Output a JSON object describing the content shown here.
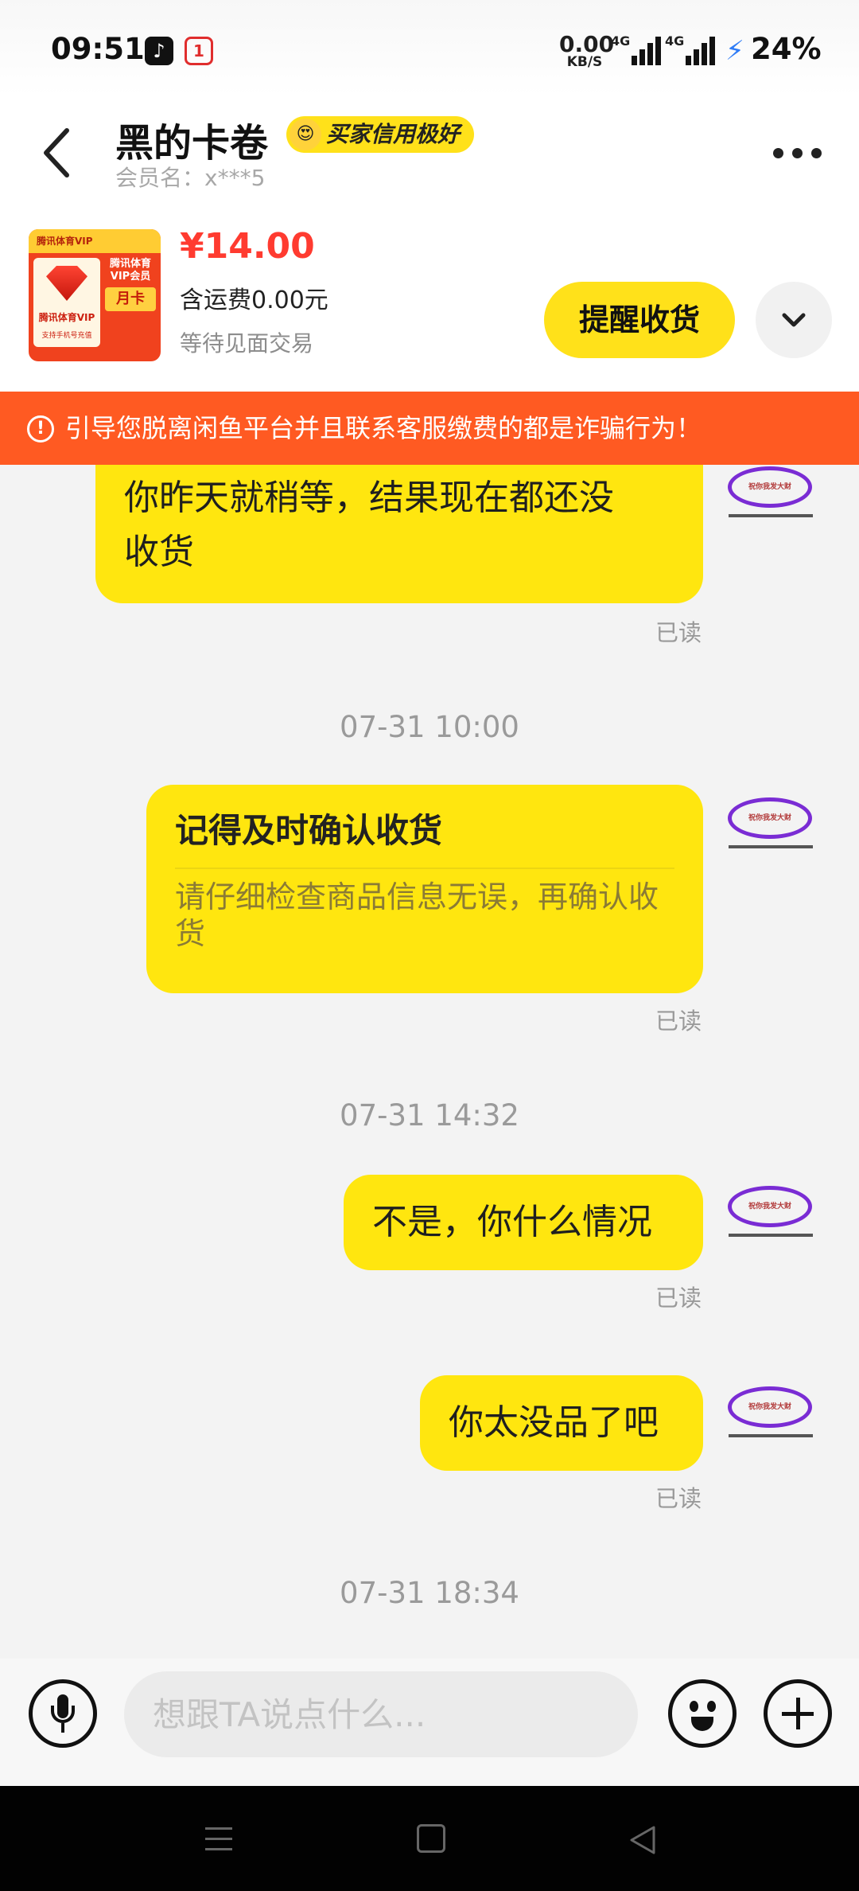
{
  "status_bar": {
    "time": "09:51",
    "net_speed": "0.00",
    "net_unit": "KB/S",
    "signal1": "4G",
    "signal2": "4G",
    "battery": "24%",
    "tiktok_icon": "tiktok-icon",
    "oneplus_icon": "oneplus-community-icon",
    "charging_color": "#2f7cf6"
  },
  "header": {
    "seller_name": "黑的卡卷",
    "credit_badge": "买家信用极好",
    "credit_face": "😍",
    "member_label": "会员名：x***5"
  },
  "product": {
    "thumb_top": "腾讯体育VIP",
    "thumb_vip": "腾讯体育VIP会员",
    "thumb_month": "月卡",
    "thumb_caption": "腾讯体育VIP",
    "thumb_sub": "支持手机号充值",
    "price": "¥14.00",
    "shipping": "含运费0.00元",
    "trade_status": "等待见面交易",
    "remind_button": "提醒收货"
  },
  "warning": {
    "text": "引导您脱离闲鱼平台并且联系客服缴费的都是诈骗行为！",
    "color": "#ff5a22"
  },
  "avatar": {
    "text": "祝你我发大财"
  },
  "messages": {
    "m1": {
      "text_line1": "你昨天就稍等，结果现在都还没",
      "text_line2": "收货",
      "read": "已读"
    },
    "ts1": "07-31 10:00",
    "m2": {
      "title": "记得及时确认收货",
      "body": "请仔细检查商品信息无误，再确认收货",
      "read": "已读"
    },
    "ts2": "07-31 14:32",
    "m3": {
      "text": "不是，你什么情况",
      "read": "已读"
    },
    "m4": {
      "text": "你太没品了吧",
      "read": "已读"
    },
    "ts3": "07-31 18:34"
  },
  "input": {
    "placeholder": "想跟TA说点什么..."
  },
  "colors": {
    "accent_yellow": "#ffe60f",
    "price_red": "#ff3b30"
  }
}
